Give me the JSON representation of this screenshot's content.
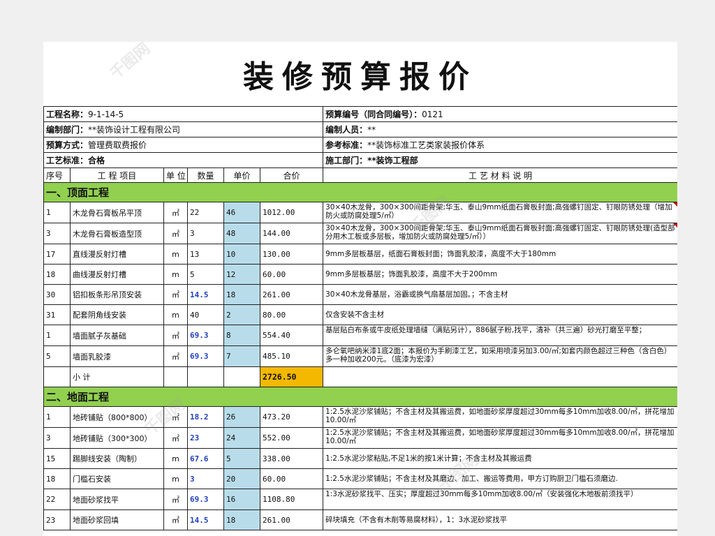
{
  "title": "装修预算报价",
  "info": {
    "project_label": "工程名称：",
    "project_value": "9-1-14-5",
    "budget_no_label": "预算编号（同合同编号）：",
    "budget_no_value": "0121",
    "dept_label": "编制部门：",
    "dept_value": "**装饰设计工程有限公司",
    "preparer_label": "编制人员：",
    "preparer_value": "**",
    "method_label": "预算方式：",
    "method_value": "管理费取费报价",
    "ref_label": "参考标准：",
    "ref_value": "**装饰标准工艺类家装报价体系",
    "std_label": "工艺标准：",
    "std_value": "合格",
    "constr_label": "施工部门：",
    "constr_value": "**装饰工程部"
  },
  "columns": [
    "序号",
    "工 程 项目",
    "单 位",
    "数量",
    "单价",
    "合价",
    "工 艺 材 料 说 明"
  ],
  "section1": {
    "title": "一、顶面工程",
    "rows": [
      {
        "no": "1",
        "name": "木龙骨石膏板吊平顶",
        "unit": "㎡",
        "qty": "22",
        "price": "46",
        "total": "1012.00",
        "desc": "30×40木龙骨，300×300间距骨架;华玉、泰山9mm纸面石膏板封面;高强螺钉固定、钉眼防锈处理（增加防火或防腐处理5/㎡）"
      },
      {
        "no": "3",
        "name": "木龙骨石膏板造型顶",
        "unit": "㎡",
        "qty": "3",
        "price": "48",
        "total": "144.00",
        "desc": "30×40木龙骨，300×300间距骨架;华玉、泰山9mm纸面石膏板封面;高强螺钉固定、钉眼防锈处理(造型部分用木工板或多层板，增加防火或防腐处理5/㎡））"
      },
      {
        "no": "17",
        "name": "直线漫反射灯槽",
        "unit": "m",
        "qty": "13",
        "price": "10",
        "total": "130.00",
        "desc": "9mm多层板基层，纸面石膏板封面；饰面乳胶漆，高度不大于180mm"
      },
      {
        "no": "18",
        "name": "曲线漫反射灯槽",
        "unit": "m",
        "qty": "5",
        "price": "12",
        "total": "60.00",
        "desc": "9mm多层板基层；饰面乳胶漆，高度不大于200mm"
      },
      {
        "no": "30",
        "name": "铝扣板条形吊顶安装",
        "unit": "㎡",
        "qty": "14.5",
        "price": "18",
        "total": "261.00",
        "desc": "30×40木龙骨基层，浴霸或换气扇基层加固。；不含主材"
      },
      {
        "no": "31",
        "name": "配套阴角线安装",
        "unit": "m",
        "qty": "40",
        "price": "2",
        "total": "80.00",
        "desc": "仅含安装不含主材"
      },
      {
        "no": "1",
        "name": "墙面腻子灰基础",
        "unit": "㎡",
        "qty": "69.3",
        "price": "8",
        "total": "554.40",
        "desc": "基层贴白布条或牛皮纸处理墙缝（满贴另计），886腻子粉,找平，清补（共三遍）砂光打磨至平整；"
      },
      {
        "no": "5",
        "name": "墙面乳胶漆",
        "unit": "㎡",
        "qty": "69.3",
        "price": "7",
        "total": "485.10",
        "desc": "多仑氧吧纳米漆1底2面；本报价为手刷漆工艺，如采用喷漆另加3.00/㎡;如套内颜色超过三种色（含白色）多一种加收200元。（底漆为宏漆）"
      }
    ],
    "subtotal_label": "小 计",
    "subtotal_value": "2726.50"
  },
  "section2": {
    "title": "二、地面工程",
    "rows": [
      {
        "no": "1",
        "name": "地砖铺贴（800*800）",
        "unit": "㎡",
        "qty": "18.2",
        "price": "26",
        "total": "473.20",
        "desc": "1:2.5水泥沙浆铺贴；不含主材及其搬运费，如地面砂浆厚度超过30mm每多10mm加收8.00/㎡，拼花增加10.00/㎡"
      },
      {
        "no": "3",
        "name": "地砖铺贴（300*300）",
        "unit": "㎡",
        "qty": "23",
        "price": "24",
        "total": "552.00",
        "desc": "1:2.5水泥沙浆铺贴；不含主材及其搬运费，如地面砂浆厚度超过30mm每多10mm加收8.00/㎡，拼花增加10.00/㎡"
      },
      {
        "no": "15",
        "name": "踢脚线安装（陶制）",
        "unit": "m",
        "qty": "67.6",
        "price": "5",
        "total": "338.00",
        "desc": "1:2.5水泥沙浆粘贴,不足1米的按1米计算；不含主材及其搬运费"
      },
      {
        "no": "18",
        "name": "门槛石安装",
        "unit": "m",
        "qty": "3",
        "price": "20",
        "total": "60.00",
        "desc": "1:2.5水泥沙浆铺贴；不含主材及其磨边、加工、搬运等费用，甲方订购厨卫门槛石须磨边."
      },
      {
        "no": "22",
        "name": "地面砂浆找平",
        "unit": "㎡",
        "qty": "69.3",
        "price": "16",
        "total": "1108.80",
        "desc": "1:3水泥砂浆找平、压实；厚度超过30mm每多10mm加收8.00/㎡（安装强化木地板前须找平）"
      },
      {
        "no": "23",
        "name": "地面砂浆回填",
        "unit": "㎡",
        "qty": "14.5",
        "price": "18",
        "total": "261.00",
        "desc": "碎块填充（不含有木削等易腐材料），1：3水泥砂浆找平"
      }
    ]
  }
}
